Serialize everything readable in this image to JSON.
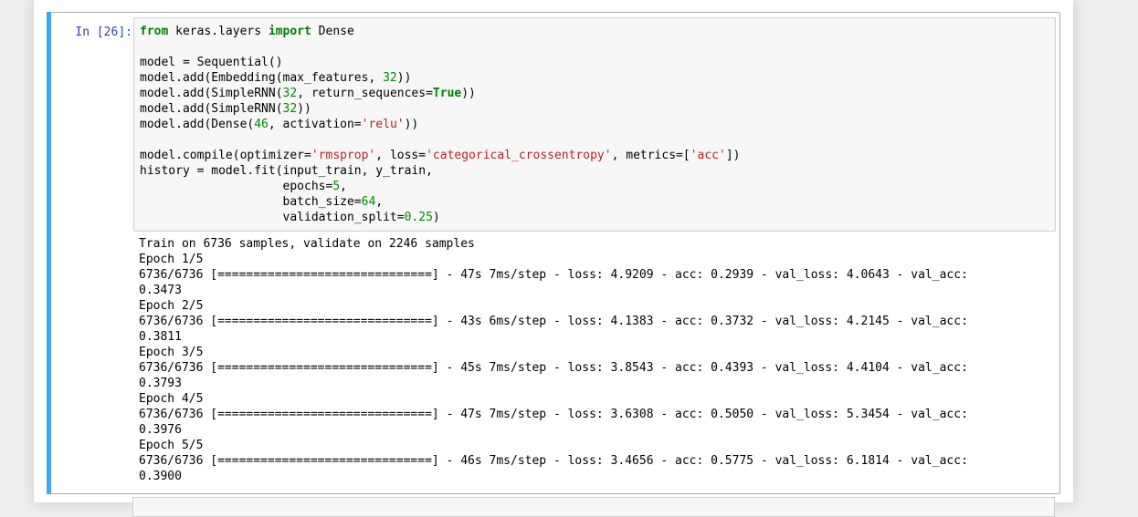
{
  "cell": {
    "prompt": "In [26]:",
    "code_lines": [
      [
        {
          "t": "from",
          "c": "kw"
        },
        {
          "t": " keras.layers "
        },
        {
          "t": "import",
          "c": "kw"
        },
        {
          "t": " Dense"
        }
      ],
      [],
      [
        {
          "t": "model = Sequential()"
        }
      ],
      [
        {
          "t": "model.add(Embedding(max_features, "
        },
        {
          "t": "32",
          "c": "num"
        },
        {
          "t": "))"
        }
      ],
      [
        {
          "t": "model.add(SimpleRNN("
        },
        {
          "t": "32",
          "c": "num"
        },
        {
          "t": ", return_sequences="
        },
        {
          "t": "True",
          "c": "kw"
        },
        {
          "t": "))"
        }
      ],
      [
        {
          "t": "model.add(SimpleRNN("
        },
        {
          "t": "32",
          "c": "num"
        },
        {
          "t": "))"
        }
      ],
      [
        {
          "t": "model.add(Dense("
        },
        {
          "t": "46",
          "c": "num"
        },
        {
          "t": ", activation="
        },
        {
          "t": "'relu'",
          "c": "str"
        },
        {
          "t": "))"
        }
      ],
      [],
      [
        {
          "t": "model.compile(optimizer="
        },
        {
          "t": "'rmsprop'",
          "c": "str"
        },
        {
          "t": ", loss="
        },
        {
          "t": "'categorical_crossentropy'",
          "c": "str"
        },
        {
          "t": ", metrics=["
        },
        {
          "t": "'acc'",
          "c": "str"
        },
        {
          "t": "])"
        }
      ],
      [
        {
          "t": "history = model.fit(input_train, y_train,"
        }
      ],
      [
        {
          "t": "                    epochs="
        },
        {
          "t": "5",
          "c": "num"
        },
        {
          "t": ","
        }
      ],
      [
        {
          "t": "                    batch_size="
        },
        {
          "t": "64",
          "c": "num"
        },
        {
          "t": ","
        }
      ],
      [
        {
          "t": "                    validation_split="
        },
        {
          "t": "0.25",
          "c": "num"
        },
        {
          "t": ")"
        }
      ]
    ],
    "output_lines": [
      "Train on 6736 samples, validate on 2246 samples",
      "Epoch 1/5",
      "6736/6736 [==============================] - 47s 7ms/step - loss: 4.9209 - acc: 0.2939 - val_loss: 4.0643 - val_acc:",
      "0.3473",
      "Epoch 2/5",
      "6736/6736 [==============================] - 43s 6ms/step - loss: 4.1383 - acc: 0.3732 - val_loss: 4.2145 - val_acc:",
      "0.3811",
      "Epoch 3/5",
      "6736/6736 [==============================] - 45s 7ms/step - loss: 3.8543 - acc: 0.4393 - val_loss: 4.4104 - val_acc:",
      "0.3793",
      "Epoch 4/5",
      "6736/6736 [==============================] - 47s 7ms/step - loss: 3.6308 - acc: 0.5050 - val_loss: 5.3454 - val_acc:",
      "0.3976",
      "Epoch 5/5",
      "6736/6736 [==============================] - 46s 7ms/step - loss: 3.4656 - acc: 0.5775 - val_loss: 6.1814 - val_acc:",
      "0.3900"
    ]
  },
  "colors": {
    "selected_cell_bar": "#42a5f5",
    "prompt": "#303f9f",
    "keyword": "#008000",
    "number": "#008800",
    "string": "#ba2121"
  }
}
